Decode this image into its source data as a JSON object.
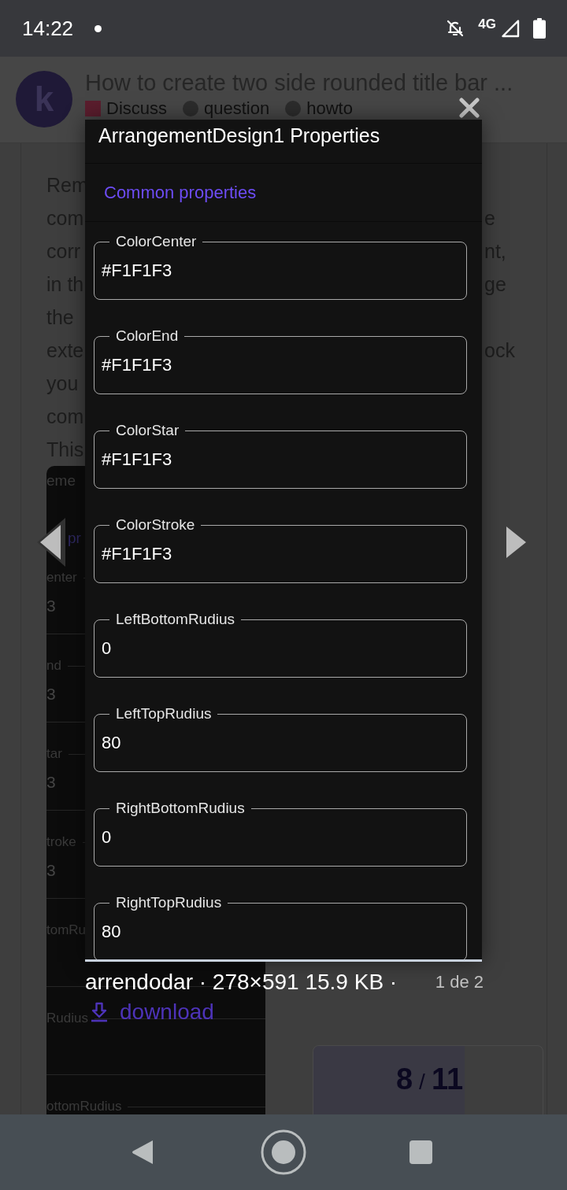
{
  "status_bar": {
    "time": "14:22",
    "network": "4G"
  },
  "topic_header": {
    "logo_letter": "k",
    "title": "How to create two side rounded title bar ...",
    "badges": [
      {
        "label": "Discuss",
        "kind": "category",
        "color": "#5a1d2d"
      },
      {
        "label": "question",
        "kind": "tag",
        "color": "#2c2c2c"
      },
      {
        "label": "howto",
        "kind": "tag",
        "color": "#2c2c2c"
      }
    ]
  },
  "post": {
    "lines": [
      {
        "left": "Rem"
      },
      {
        "left": "com",
        "right": "e"
      },
      {
        "left": "corr",
        "right": "nt,"
      },
      {
        "left": "in th",
        "right": "ge"
      },
      {
        "left": "the"
      },
      {
        "left": "exte",
        "right": "ock"
      },
      {
        "left": "you"
      },
      {
        "left": "com"
      },
      {
        "left": "This"
      }
    ],
    "embedded_image": {
      "title_fragment": "eme",
      "section_fragment": "pr",
      "rows": [
        {
          "label": "enter",
          "value": "3"
        },
        {
          "label": "nd",
          "value": "3"
        },
        {
          "label": "tar",
          "value": "3"
        },
        {
          "label": "troke",
          "value": "3"
        },
        {
          "label": "tomRu"
        },
        {
          "label": "Rudius"
        },
        {
          "label": "ottomRudius"
        }
      ]
    }
  },
  "topic_progress": {
    "current": "8",
    "separator": "/",
    "total": "11",
    "level": 0.66
  },
  "lightbox": {
    "image": {
      "title": "ArrangementDesign1 Properties",
      "section": "Common properties",
      "fields": [
        {
          "label": "ColorCenter",
          "value": "#F1F1F3"
        },
        {
          "label": "ColorEnd",
          "value": "#F1F1F3"
        },
        {
          "label": "ColorStar",
          "value": "#F1F1F3"
        },
        {
          "label": "ColorStroke",
          "value": "#F1F1F3"
        },
        {
          "label": "LeftBottomRudius",
          "value": "0"
        },
        {
          "label": "LeftTopRudius",
          "value": "80"
        },
        {
          "label": "RightBottomRudius",
          "value": "0"
        },
        {
          "label": "RightTopRudius",
          "value": "80"
        }
      ]
    },
    "caption": "arrendodar · 278×591 15.9 KB ·",
    "counter": "1 de 2",
    "download_label": "download"
  }
}
